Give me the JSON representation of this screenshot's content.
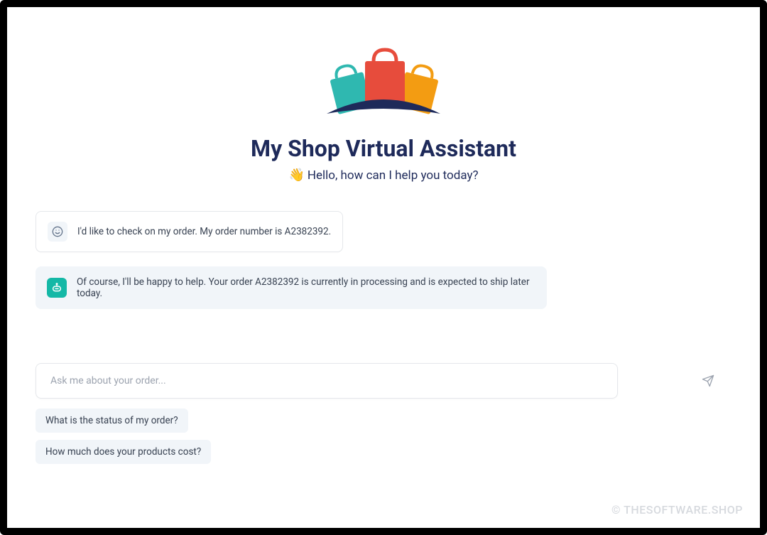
{
  "header": {
    "title": "My Shop Virtual Assistant",
    "subtitle": "Hello, how can I help you today?",
    "wave_emoji": "👋"
  },
  "messages": {
    "user_text": "I'd like to check on my order. My order number is A2382392.",
    "assistant_text": "Of course, I'll be happy to help. Your order A2382392 is currently in processing and is expected to ship later today."
  },
  "input": {
    "placeholder": "Ask me about your order..."
  },
  "suggestions": {
    "item_0": "What is the status of my order?",
    "item_1": "How much does your products cost?"
  },
  "watermark": "© THESOFTWARE.SHOP",
  "colors": {
    "primary_text": "#1e2a5a",
    "teal": "#14b8a6",
    "red": "#e74c3c",
    "orange": "#f39c12",
    "navy_swoosh": "#1e2a5a"
  }
}
